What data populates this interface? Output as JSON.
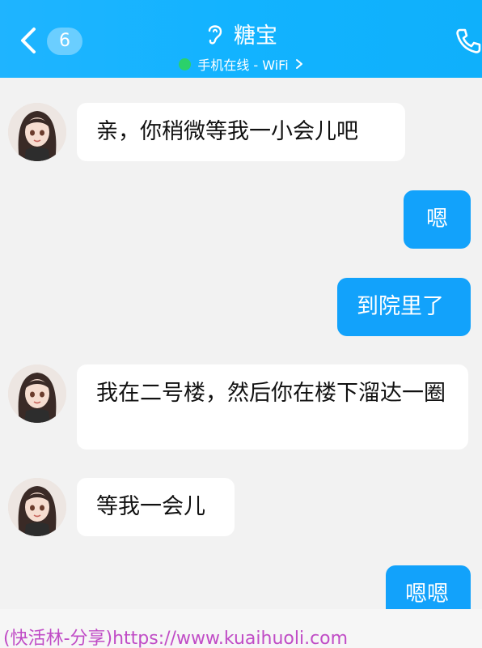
{
  "header": {
    "back_badge": "6",
    "title": "糖宝",
    "status": "手机在线 - WiFi",
    "colors": {
      "bar": "#12b3ff",
      "online": "#2bd16a"
    },
    "icons": [
      "back-arrow-icon",
      "ear-icon",
      "chevron-right-icon",
      "phone-icon"
    ]
  },
  "messages": [
    {
      "side": "in",
      "text": "亲，你稍微等我一小会儿吧"
    },
    {
      "side": "out",
      "text": "嗯"
    },
    {
      "side": "out",
      "text": "到院里了"
    },
    {
      "side": "in",
      "text": "我在二号楼，然后你在楼下溜达一圈"
    },
    {
      "side": "in",
      "text": "等我一会儿"
    },
    {
      "side": "out",
      "text": "嗯嗯"
    }
  ],
  "watermark": "(快活林-分享)https://www.kuaihuoli.com",
  "colors": {
    "outgoing_bubble": "#12a2fb",
    "incoming_bubble": "#ffffff",
    "background": "#f2f2f2"
  }
}
